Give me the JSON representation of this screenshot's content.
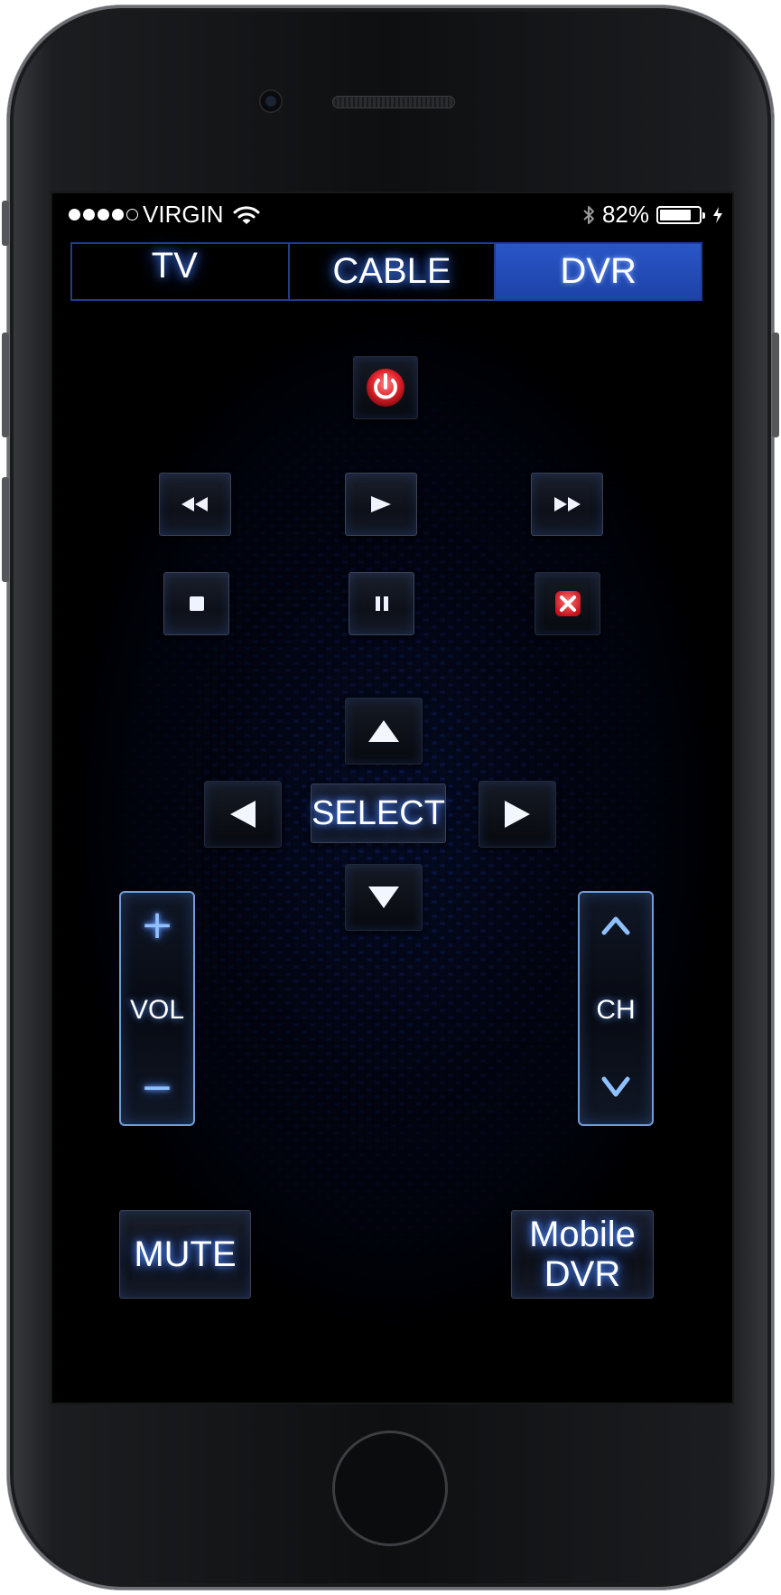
{
  "status_bar": {
    "carrier": "VIRGIN",
    "signal_dots_filled": 4,
    "signal_dots_total": 5,
    "battery_percent_text": "82%",
    "battery_level": 0.82,
    "icons": [
      "wifi-icon",
      "bluetooth-icon",
      "battery-icon",
      "charging-icon"
    ]
  },
  "tabs": [
    {
      "label": "TV",
      "active": false
    },
    {
      "label": "CABLE",
      "active": false
    },
    {
      "label": "DVR",
      "active": true
    }
  ],
  "colors": {
    "accent_blue": "#1d43a8",
    "glow_blue": "#4d8cff",
    "power_red": "#e0202a",
    "rocker_border": "#6f9ed6"
  },
  "buttons": {
    "power": {
      "icon": "power-icon"
    },
    "transport": {
      "rewind": {
        "icon": "rewind-icon"
      },
      "play": {
        "icon": "play-icon"
      },
      "fast_forward": {
        "icon": "fast-forward-icon"
      },
      "stop": {
        "icon": "stop-icon"
      },
      "pause": {
        "icon": "pause-icon"
      },
      "cancel": {
        "icon": "close-icon"
      }
    },
    "dpad": {
      "up": {
        "icon": "arrow-up-icon"
      },
      "down": {
        "icon": "arrow-down-icon"
      },
      "left": {
        "icon": "arrow-left-icon"
      },
      "right": {
        "icon": "arrow-right-icon"
      },
      "select_label": "SELECT"
    },
    "volume": {
      "label": "VOL",
      "up_glyph": "+",
      "down_glyph": "−"
    },
    "channel": {
      "label": "CH",
      "up_glyph": "^",
      "down_glyph": "v"
    },
    "mute_label": "MUTE",
    "mobile_dvr_line1": "Mobile",
    "mobile_dvr_line2": "DVR"
  }
}
